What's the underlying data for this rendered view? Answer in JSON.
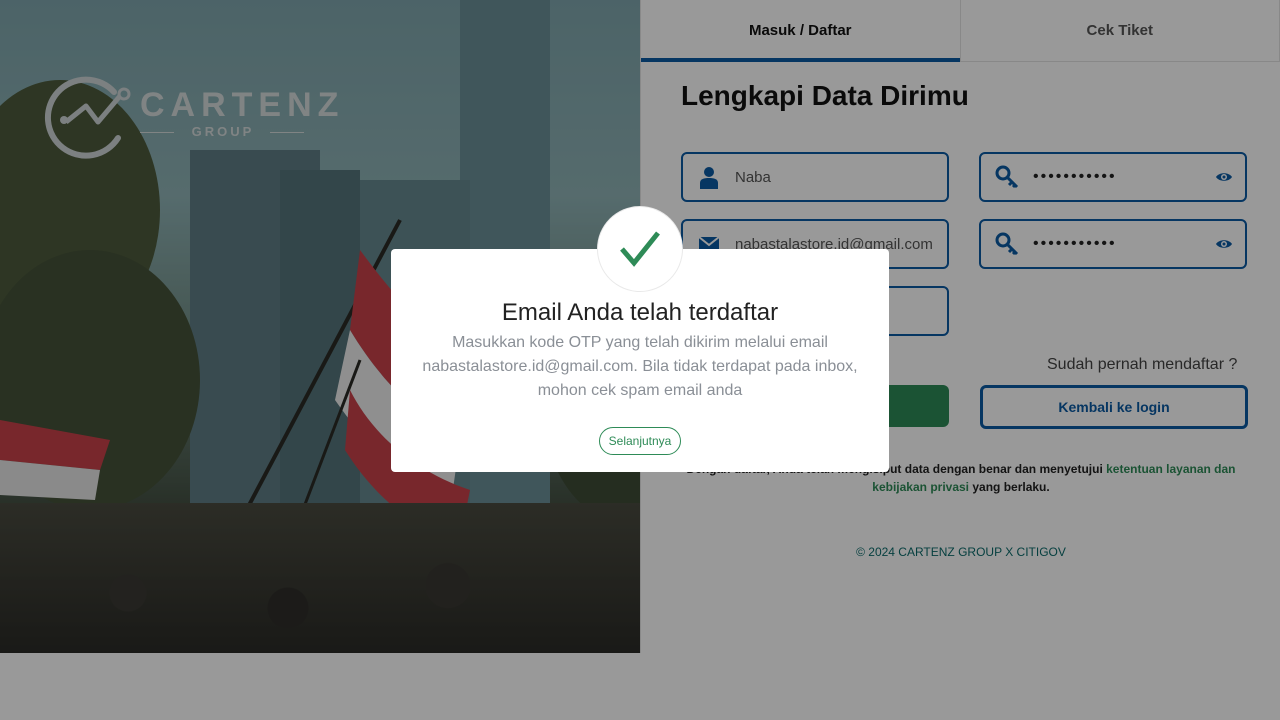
{
  "brand": {
    "name": "CARTENZ",
    "tagline": "GROUP"
  },
  "tabs": [
    {
      "label": "Masuk / Daftar",
      "active": true
    },
    {
      "label": "Cek Tiket",
      "active": false
    }
  ],
  "form": {
    "title": "Lengkapi Data Dirimu",
    "name_value": "Naba",
    "email_value": "nabastalastore.id@gmail.com",
    "password_value": "•••••••••••",
    "confirm_password_value": "•••••••••••",
    "already_registered": "Sudah pernah mendaftar ?",
    "back_to_login": "Kembali ke login"
  },
  "terms": {
    "prefix": "Dengan daftar, Anda telah mengisi",
    "middle": "put data dengan benar dan menyetujui ",
    "link1": "ketentuan layanan dan",
    "link2": "kebijakan privasi",
    "suffix": " yang berlaku."
  },
  "footer": {
    "copyright": "© 2024 CARTENZ GROUP X CITIGOV"
  },
  "modal": {
    "title": "Email Anda telah terdaftar",
    "body": "Masukkan kode OTP yang telah dikirim melalui email nabastalastore.id@gmail.com. Bila tidak terdapat pada inbox, mohon cek spam email anda",
    "button": "Selanjutnya"
  },
  "colors": {
    "primary": "#0a5aa3",
    "green": "#2e8b57"
  }
}
